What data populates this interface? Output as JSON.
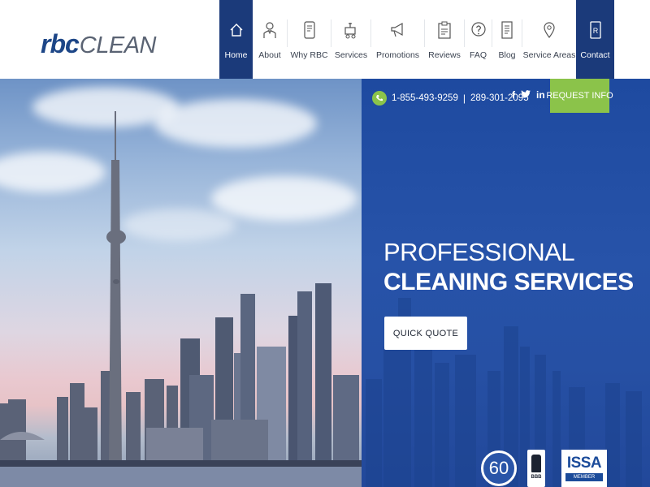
{
  "brand": {
    "logo_rbc": "rbc",
    "logo_clean": "CLEAN"
  },
  "nav": {
    "items": [
      {
        "label": "Home",
        "icon": "home-icon"
      },
      {
        "label": "About",
        "icon": "person-icon"
      },
      {
        "label": "Why RBC",
        "icon": "phone-document-icon"
      },
      {
        "label": "Services",
        "icon": "cleaning-cart-icon"
      },
      {
        "label": "Promotions",
        "icon": "megaphone-icon"
      },
      {
        "label": "Reviews",
        "icon": "clipboard-icon"
      },
      {
        "label": "FAQ",
        "icon": "question-bubble-icon"
      },
      {
        "label": "Blog",
        "icon": "document-icon"
      },
      {
        "label": "Service Areas",
        "icon": "map-pin-icon"
      },
      {
        "label": "Contact",
        "icon": "contact-book-icon"
      }
    ]
  },
  "contact": {
    "phone1": "1-855-493-9259",
    "separator": "|",
    "phone2": "289-301-2095",
    "request_label": "REQUEST INFO",
    "social_facebook": "f",
    "social_twitter": "t",
    "social_linkedin": "in"
  },
  "hero": {
    "line1": "PROFESSIONAL",
    "line2": "CLEANING SERVICES",
    "cta_label": "QUICK QUOTE"
  },
  "badges": {
    "years": "60",
    "bbb_text": "BBB",
    "issa_text": "ISSA",
    "issa_sub": "MEMBER"
  },
  "colors": {
    "brand_blue": "#1b3a7a",
    "accent_green": "#8bc34a",
    "hero_blue": "#2650a4"
  }
}
